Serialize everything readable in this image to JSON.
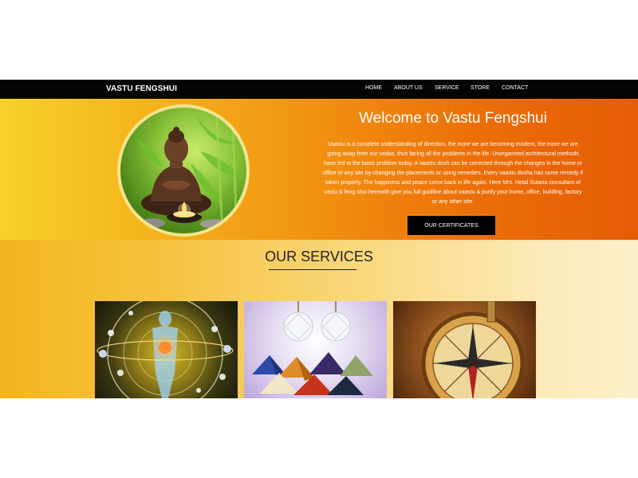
{
  "navbar": {
    "brand": "VASTU FENGSHUI",
    "links": [
      "HOME",
      "ABOUT US",
      "SERVICE",
      "STORE",
      "CONTACT"
    ]
  },
  "hero": {
    "title": "Welcome to Vastu Fengshui",
    "paragraph": "Vaastu is a complete understanding of direction, the more we are becoming modern, the more we are going away from our vedas, thus facing all the problems in the life. Unorganised architectural methods have led to the basic problem today. A vaastu dosh can be corrected through the changes in the home or office or any site by changing the placements or using remedies. Every vaastu dosha has some remedy if taken properly. The happiness and peace come back in life again. Here Mrs. Hetal Sutaria consultant of vastu & feng shui herewith give you full guidline about vaastu & purify your home, office, building, factory or any other site.",
    "button": "OUR CERTIFICATES",
    "image_icon": "buddha-statue-icon"
  },
  "services": {
    "title": "OUR SERVICES",
    "cards": [
      {
        "icon": "astrology-zodiac-icon"
      },
      {
        "icon": "crystal-pyramids-icon"
      },
      {
        "icon": "compass-icon"
      }
    ]
  },
  "colors": {
    "navbar": "#050505",
    "hero_start": "#f7d12a",
    "hero_end": "#e55c06",
    "services_start": "#f4b51c",
    "services_end": "#fcefc9",
    "button": "#000000"
  }
}
